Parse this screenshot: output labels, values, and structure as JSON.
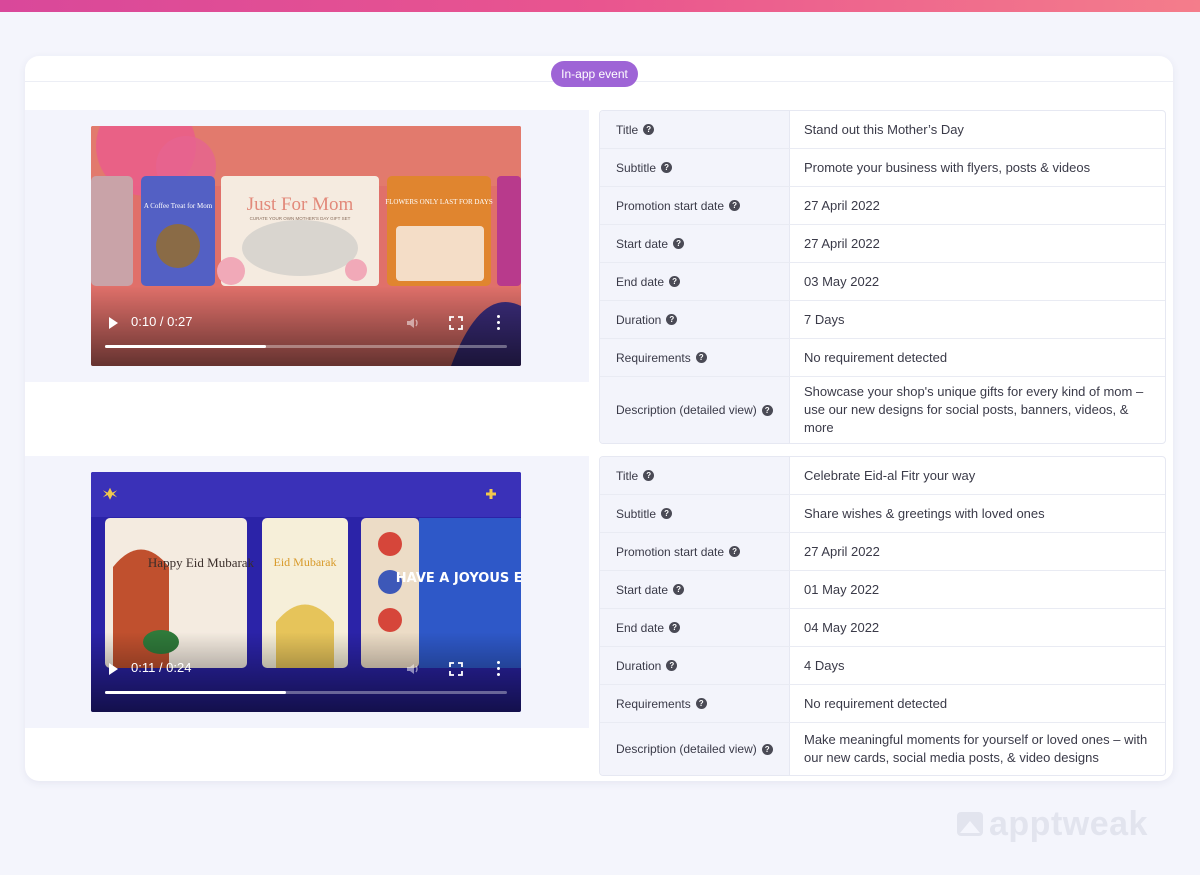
{
  "badge": "In-app event",
  "events": [
    {
      "video": {
        "time": "0:10 / 0:27",
        "progress": 0.4
      },
      "rows": [
        {
          "label": "Title",
          "value": "Stand out this Mother’s Day"
        },
        {
          "label": "Subtitle",
          "value": "Promote your business with flyers, posts & videos"
        },
        {
          "label": "Promotion start date",
          "value": "27 April 2022"
        },
        {
          "label": "Start date",
          "value": "27 April 2022"
        },
        {
          "label": "End date",
          "value": "03 May 2022"
        },
        {
          "label": "Duration",
          "value": "7 Days"
        },
        {
          "label": "Requirements",
          "value": "No requirement detected"
        },
        {
          "label": "Description (detailed view)",
          "value": "Showcase your shop's unique gifts for every kind of mom – use our new designs for social posts, banners, videos, & more"
        }
      ]
    },
    {
      "video": {
        "time": "0:11 / 0:24",
        "progress": 0.45
      },
      "rows": [
        {
          "label": "Title",
          "value": "Celebrate Eid-al Fitr your way"
        },
        {
          "label": "Subtitle",
          "value": "Share wishes & greetings with loved ones"
        },
        {
          "label": "Promotion start date",
          "value": "27 April 2022"
        },
        {
          "label": "Start date",
          "value": "01 May 2022"
        },
        {
          "label": "End date",
          "value": "04 May 2022"
        },
        {
          "label": "Duration",
          "value": "4 Days"
        },
        {
          "label": "Requirements",
          "value": "No requirement detected"
        },
        {
          "label": "Description (detailed view)",
          "value": "Make meaningful moments for yourself or loved ones – with our new cards, social media posts, & video designs"
        }
      ]
    }
  ],
  "video1_art": {
    "card1": "A Coffee Treat for Mom",
    "card2_title": "Just For Mom",
    "card2_sub": "CURATE YOUR OWN MOTHER'S DAY GIFT SET",
    "card3": "FLOWERS ONLY LAST FOR DAYS"
  },
  "video2_art": {
    "card1": "Happy Eid Mubarak",
    "card2": "Eid Mubarak",
    "card3": "HAVE A JOYOUS EID!"
  },
  "watermark": "apptweak",
  "colors": {
    "accent": "#9e64d6",
    "topbar": "#e9558f"
  }
}
